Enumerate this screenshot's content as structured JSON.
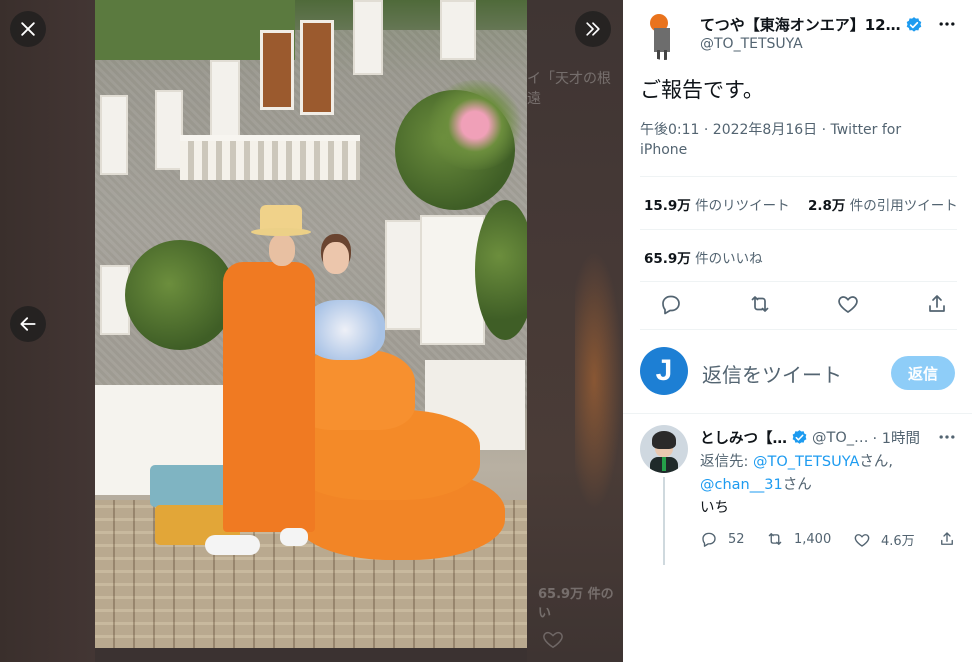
{
  "viewer": {
    "background_text_top": "イ「天才の根遠",
    "background_text_bottom": "65.9万 件のい",
    "photo_description_icons": [
      "close-icon",
      "expand-icon",
      "arrow-left-icon"
    ]
  },
  "tweet": {
    "display_name": "てつや【東海オンエア】12…",
    "handle": "@TO_TETSUYA",
    "text": "ご報告です。",
    "time": "午後0:11 · 2022年8月16日 · ",
    "source": "Twitter for iPhone",
    "retweets_count": "15.9万",
    "retweets_label": " 件のリツイート",
    "quotes_count": "2.8万",
    "quotes_label": " 件の引用ツイート",
    "likes_count": "65.9万",
    "likes_label": " 件のいいね"
  },
  "compose": {
    "avatar_letter": "J",
    "placeholder": "返信をツイート",
    "button": "返信"
  },
  "reply": {
    "display_name": "としみつ【…",
    "handle": "@TO_…",
    "time": "· 1時間",
    "prefix": "返信先: ",
    "mention1": "@TO_TETSUYA",
    "suffix1": "さん,",
    "mention2": "@chan__31",
    "suffix2": "さん",
    "text": "いち",
    "replies": "52",
    "retweets": "1,400",
    "likes": "4.6万"
  },
  "colors": {
    "accent": "#1d9bf0",
    "reply_button": "#8ecdf8",
    "secondary_text": "#536471",
    "primary_text": "#0f1419",
    "viewer_bg": "#3b3231"
  }
}
